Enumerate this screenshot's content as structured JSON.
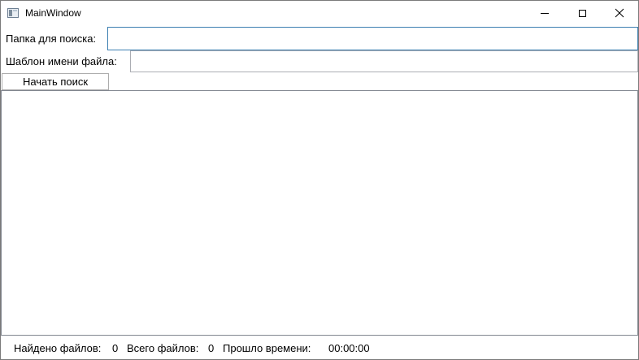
{
  "window": {
    "title": "MainWindow",
    "icon": "app-window-icon",
    "controls": [
      "minimize-icon",
      "maximize-icon",
      "close-icon"
    ]
  },
  "form": {
    "folder_label": "Папка для поиска:",
    "folder_value": "",
    "pattern_label": "Шаблон имени файла:",
    "pattern_value": "",
    "search_button": "Начать поиск"
  },
  "results": {
    "items": []
  },
  "status": {
    "found_label": "Найдено файлов:",
    "found_value": "0",
    "total_label": "Всего файлов:",
    "total_value": "0",
    "time_label": "Прошло времени:",
    "time_value": "00:00:00"
  },
  "colors": {
    "focus_border": "#3c7fb1",
    "field_border": "#abadb3",
    "button_border": "#adadad",
    "window_border": "#7a7a7a"
  }
}
